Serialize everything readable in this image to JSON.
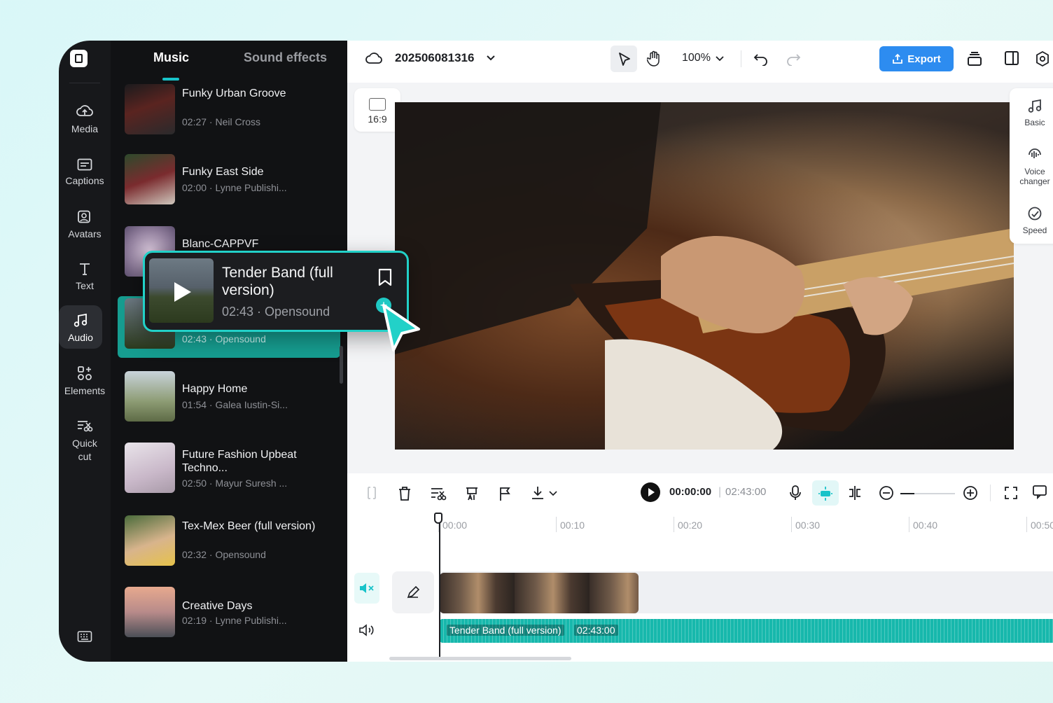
{
  "rail": {
    "items": [
      {
        "label": "Media",
        "icon": "cloud-upload-icon"
      },
      {
        "label": "Captions",
        "icon": "captions-icon"
      },
      {
        "label": "Avatars",
        "icon": "avatar-icon"
      },
      {
        "label": "Text",
        "icon": "text-icon"
      },
      {
        "label": "Audio",
        "icon": "music-note-icon",
        "active": true
      },
      {
        "label": "Elements",
        "icon": "elements-icon"
      },
      {
        "label": "Quick cut",
        "icon": "quick-cut-icon"
      }
    ]
  },
  "panel": {
    "tabs": [
      {
        "label": "Music",
        "active": true
      },
      {
        "label": "Sound effects"
      }
    ],
    "tracks": [
      {
        "title": "Funky Urban Groove",
        "meta": "02:27 · Neil Cross"
      },
      {
        "title": "Funky East Side",
        "meta": "02:00 · Lynne Publishi..."
      },
      {
        "title": "Blanc-CAPPVF",
        "meta": ""
      },
      {
        "title": "",
        "meta": "02:43 · Opensound"
      },
      {
        "title": "Happy Home",
        "meta": "01:54 · Galea Iustin-Si..."
      },
      {
        "title": "Future Fashion Upbeat Techno...",
        "meta": "02:50 · Mayur Suresh ..."
      },
      {
        "title": "Tex-Mex Beer (full version)",
        "meta": "02:32 · Opensound"
      },
      {
        "title": "Creative Days",
        "meta": "02:19 · Lynne Publishi..."
      }
    ]
  },
  "popup": {
    "title": "Tender Band (full version)",
    "meta": "02:43 · Opensound"
  },
  "topbar": {
    "project_title": "202506081316",
    "zoom": "100%",
    "export_label": "Export"
  },
  "canvas": {
    "ratio": "16:9"
  },
  "right_panel": {
    "items": [
      {
        "label": "Basic"
      },
      {
        "label": "Voice changer"
      },
      {
        "label": "Speed"
      }
    ]
  },
  "timeline": {
    "current_time": "00:00:00",
    "total_time": "02:43:00",
    "ruler": [
      "00:00",
      "00:10",
      "00:20",
      "00:30",
      "00:40",
      "00:50"
    ],
    "audio_clip_label": "Tender Band (full version)",
    "audio_clip_duration": "02:43:00"
  },
  "colors": {
    "accent": "#19c3c9",
    "export": "#2d8cf0",
    "audio_track": "#17b8ac"
  }
}
